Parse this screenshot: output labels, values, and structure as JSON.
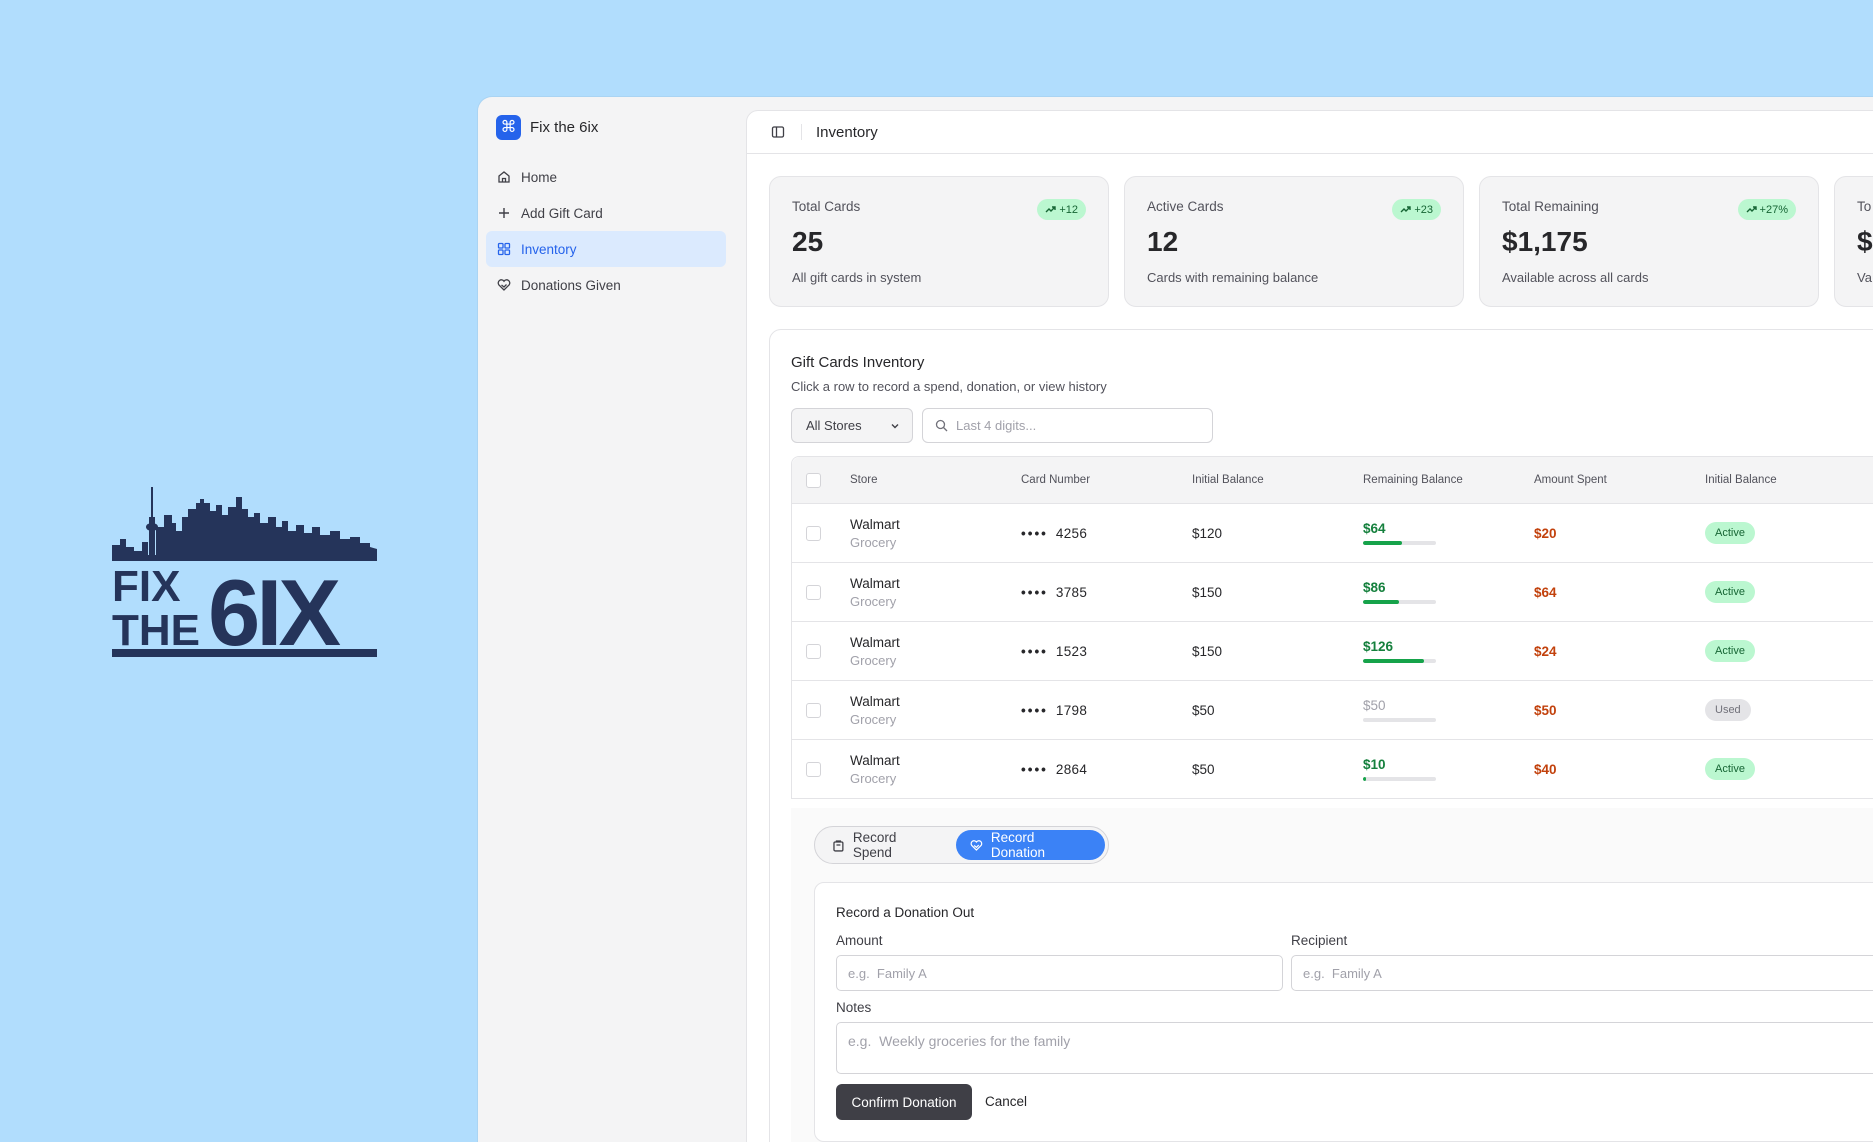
{
  "logo": {
    "line1": "FIX",
    "line2": "THE",
    "mark": "6IX",
    "color": "#25345a"
  },
  "sidebar": {
    "brand": {
      "name": "Fix the 6ix",
      "icon": "command-icon",
      "color": "#2563eb"
    },
    "items": [
      {
        "label": "Home",
        "icon": "home-icon"
      },
      {
        "label": "Add Gift Card",
        "icon": "plus-icon"
      },
      {
        "label": "Inventory",
        "icon": "grid-icon",
        "active": true
      },
      {
        "label": "Donations Given",
        "icon": "heart-hand-icon"
      }
    ]
  },
  "header": {
    "title": "Inventory",
    "toggle_icon": "sidebar-toggle-icon"
  },
  "stats": [
    {
      "label": "Total Cards",
      "value": "25",
      "desc": "All gift cards in system",
      "badge": "+12"
    },
    {
      "label": "Active Cards",
      "value": "12",
      "desc": "Cards with remaining balance",
      "badge": "+23"
    },
    {
      "label": "Total Remaining",
      "value": "$1,175",
      "desc": "Available across all cards",
      "badge": "+27%"
    },
    {
      "label": "To",
      "value": "$",
      "desc": "Va",
      "badge": ""
    }
  ],
  "inventory": {
    "title": "Gift Cards Inventory",
    "subtitle": "Click a row to record a spend, donation, or view history",
    "filter_value": "All Stores",
    "search_placeholder": "Last 4 digits...",
    "columns": [
      "Store",
      "Card Number",
      "Initial Balance",
      "Remaining Balance",
      "Amount Spent",
      "Initial Balance"
    ],
    "rows": [
      {
        "store": "Walmart",
        "type": "Grocery",
        "dots": "••••",
        "last4": "4256",
        "initial": "$120",
        "remaining": "$64",
        "remaining_fraction": 0.53,
        "spent": "$20",
        "status": "Active"
      },
      {
        "store": "Walmart",
        "type": "Grocery",
        "dots": "••••",
        "last4": "3785",
        "initial": "$150",
        "remaining": "$86",
        "remaining_fraction": 0.49,
        "spent": "$64",
        "status": "Active"
      },
      {
        "store": "Walmart",
        "type": "Grocery",
        "dots": "••••",
        "last4": "1523",
        "initial": "$150",
        "remaining": "$126",
        "remaining_fraction": 0.84,
        "spent": "$24",
        "status": "Active"
      },
      {
        "store": "Walmart",
        "type": "Grocery",
        "dots": "••••",
        "last4": "1798",
        "initial": "$50",
        "remaining": "$50",
        "remaining_fraction": 0,
        "spent": "$50",
        "status": "Used"
      },
      {
        "store": "Walmart",
        "type": "Grocery",
        "dots": "••••",
        "last4": "2864",
        "initial": "$50",
        "remaining": "$10",
        "remaining_fraction": 0.04,
        "spent": "$40",
        "status": "Active"
      }
    ]
  },
  "record": {
    "tabs": [
      {
        "label": "Record Spend",
        "icon": "bag-icon"
      },
      {
        "label": "Record Donation",
        "icon": "heart-hand-icon",
        "active": true
      }
    ],
    "form_title": "Record a Donation Out",
    "amount_label": "Amount",
    "amount_placeholder": "e.g.  Family A",
    "recipient_label": "Recipient",
    "recipient_placeholder": "e.g.  Family A",
    "notes_label": "Notes",
    "notes_placeholder": "e.g.  Weekly groceries for the family",
    "confirm_label": "Confirm Donation",
    "cancel_label": "Cancel"
  }
}
